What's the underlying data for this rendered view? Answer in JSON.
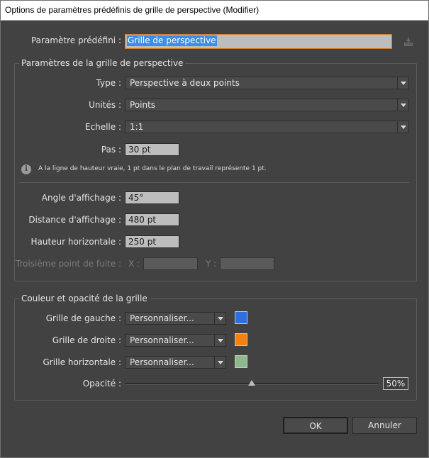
{
  "window": {
    "title": "Options de paramètres prédéfinis de grille de perspective (Modifier)"
  },
  "preset": {
    "label": "Paramètre prédéfini :",
    "value": "Grille de perspective"
  },
  "grid_params": {
    "title": "Paramètres de la grille de perspective",
    "type_label": "Type :",
    "type_value": "Perspective à deux points",
    "units_label": "Unités :",
    "units_value": "Points",
    "scale_label": "Echelle :",
    "scale_value": "1:1",
    "step_label": "Pas :",
    "step_value": "30 pt",
    "info_text": "A la ligne de hauteur vraie, 1 pt dans le plan de travail représente 1 pt.",
    "angle_label": "Angle d'affichage :",
    "angle_value": "45°",
    "distance_label": "Distance d'affichage :",
    "distance_value": "480 pt",
    "horizon_label": "Hauteur horizontale :",
    "horizon_value": "250 pt",
    "third_vp_label": "Troisième point de fuite :",
    "x_label": "X :",
    "y_label": "Y :"
  },
  "color_opacity": {
    "title": "Couleur et opacité de la grille",
    "left_label": "Grille de gauche :",
    "left_value": "Personnaliser...",
    "left_color": "#2b6fe0",
    "right_label": "Grille de droite :",
    "right_value": "Personnaliser...",
    "right_color": "#f5820f",
    "horiz_label": "Grille horizontale :",
    "horiz_value": "Personnaliser...",
    "horiz_color": "#8cb98e",
    "opacity_label": "Opacité :",
    "opacity_value": "50%",
    "opacity_fraction": 0.5
  },
  "buttons": {
    "ok": "OK",
    "cancel": "Annuler"
  }
}
